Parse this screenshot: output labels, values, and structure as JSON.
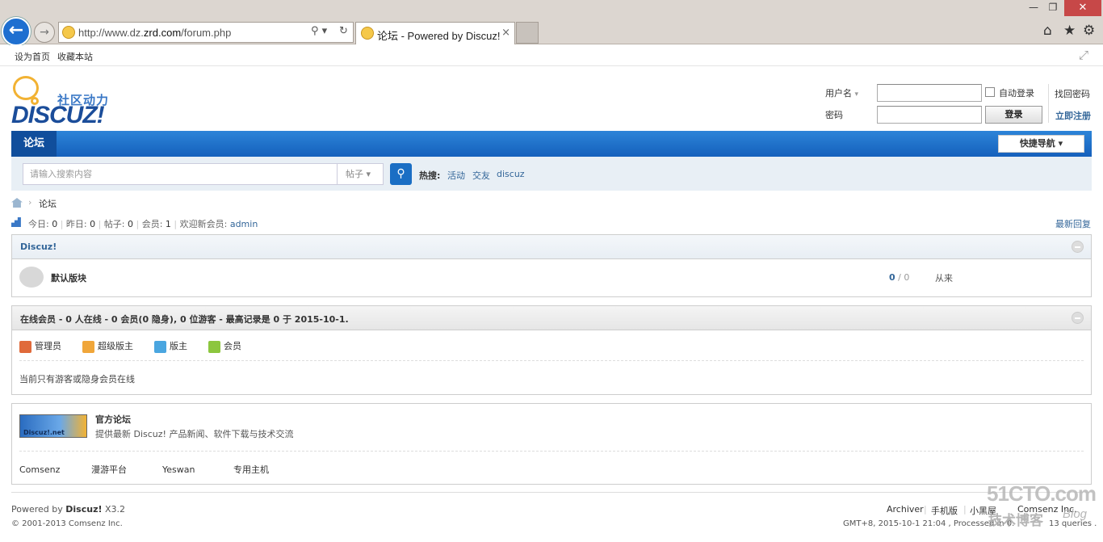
{
  "browser": {
    "url_prefix": "http://www.dz.",
    "url_domain": "zrd.com",
    "url_path": "/forum.php",
    "tab_title": "论坛 - Powered by Discuz!",
    "tab_close": "×",
    "back": "←",
    "forward": "→",
    "search_ctrl": "⚲ ▾",
    "refresh": "↻",
    "min": "—",
    "max": "❐",
    "close": "✕",
    "home_icon": "⌂",
    "star_icon": "★",
    "gear_icon": "⚙"
  },
  "favbar": {
    "set_home": "设为首页",
    "bookmark": "收藏本站",
    "expand_icon": "⤢"
  },
  "logo": {
    "cn": "社区动力",
    "en": "DISCUZ!"
  },
  "login": {
    "username_label": "用户名",
    "password_label": "密码",
    "auto_login": "自动登录",
    "login_button": "登录",
    "forgot": "找回密码",
    "register": "立即注册"
  },
  "nav": {
    "active": "论坛",
    "quick_nav": "快捷导航 ▾"
  },
  "search": {
    "placeholder": "请输入搜索内容",
    "type": "帖子 ▾",
    "button_icon": "⚲",
    "hot_label": "热搜:",
    "hot": [
      "活动",
      "交友",
      "discuz"
    ]
  },
  "breadcrumb": {
    "sep": "›",
    "current": "论坛"
  },
  "stats": {
    "today_label": "今日: ",
    "today": "0",
    "yesterday_label": "昨日: ",
    "yesterday": "0",
    "posts_label": "帖子: ",
    "posts": "0",
    "members_label": "会员: ",
    "members": "1",
    "welcome_label": "欢迎新会员: ",
    "newest": "admin",
    "latest_replies": "最新回复"
  },
  "category": {
    "title": "Discuz!",
    "forum_name": "默认版块",
    "threads": "0",
    "sep": " / ",
    "posts": "0",
    "last": "从来"
  },
  "online": {
    "title": "在线会员 - 0 人在线 - 0 会员(0 隐身), 0 位游客 - 最高记录是 0 于 2015-10-1.",
    "roles": [
      "管理员",
      "超级版主",
      "版主",
      "会员"
    ],
    "empty": "当前只有游客或隐身会员在线"
  },
  "links": {
    "banner": "Discuz!.net",
    "name": "官方论坛",
    "desc": "提供最新 Discuz! 产品新闻、软件下载与技术交流",
    "text_links": [
      "Comsenz",
      "漫游平台",
      "Yeswan",
      "专用主机"
    ]
  },
  "footer": {
    "powered": "Powered by ",
    "product": "Discuz!",
    "version": " X3.2",
    "copyright": "© 2001-2013 Comsenz Inc.",
    "links": [
      "Archiver",
      "手机版",
      "小黑屋"
    ],
    "company": "Comsenz Inc.",
    "processed": "GMT+8, 2015-10-1 21:04 , Processed in 0.",
    "queries": "13 queries ."
  },
  "watermark": {
    "line1": "51CTO.com",
    "line2": "技术博客",
    "line3": "Blog"
  },
  "colors": {
    "link": "#336699",
    "nav": "#1560bc",
    "accent": "#f2b233"
  }
}
